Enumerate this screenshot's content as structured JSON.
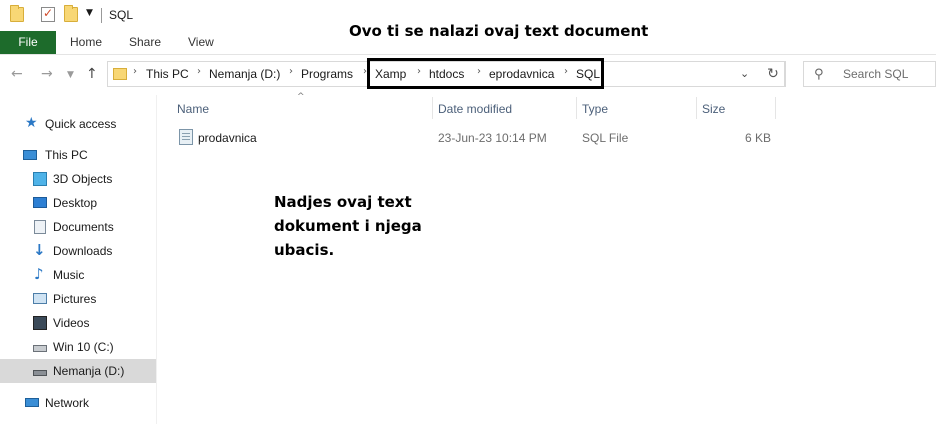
{
  "window": {
    "title": "SQL"
  },
  "ribbon": {
    "tabs": [
      "File",
      "Home",
      "Share",
      "View"
    ]
  },
  "annotations": {
    "top": "Ovo ti se nalazi ovaj text document",
    "middle": "Nadjes ovaj text dokument i njega ubacis."
  },
  "address": {
    "breadcrumbs": [
      "This PC",
      "Nemanja (D:)",
      "Programs",
      "Xamp",
      "htdocs",
      "eprodavnica",
      "SQL"
    ]
  },
  "search": {
    "placeholder": "Search SQL"
  },
  "nav": {
    "items": [
      {
        "label": "Quick access",
        "icon": "star-icon"
      },
      {
        "label": "This PC",
        "icon": "computer-icon"
      },
      {
        "label": "3D Objects",
        "icon": "cube-icon"
      },
      {
        "label": "Desktop",
        "icon": "desktop-icon"
      },
      {
        "label": "Documents",
        "icon": "documents-icon"
      },
      {
        "label": "Downloads",
        "icon": "download-arrow-icon"
      },
      {
        "label": "Music",
        "icon": "music-note-icon"
      },
      {
        "label": "Pictures",
        "icon": "pictures-icon"
      },
      {
        "label": "Videos",
        "icon": "film-icon"
      },
      {
        "label": "Win 10 (C:)",
        "icon": "drive-c-icon"
      },
      {
        "label": "Nemanja (D:)",
        "icon": "drive-d-icon",
        "selected": true
      },
      {
        "label": "Network",
        "icon": "network-icon"
      }
    ]
  },
  "columns": [
    "Name",
    "Date modified",
    "Type",
    "Size"
  ],
  "files": [
    {
      "name": "prodavnica",
      "date_modified": "23-Jun-23 10:14 PM",
      "type": "SQL File",
      "size": "6 KB"
    }
  ],
  "colors": {
    "file_tab": "#1d6b2b",
    "folder": "#f8d775",
    "selected_row": "#d9d9d9"
  }
}
